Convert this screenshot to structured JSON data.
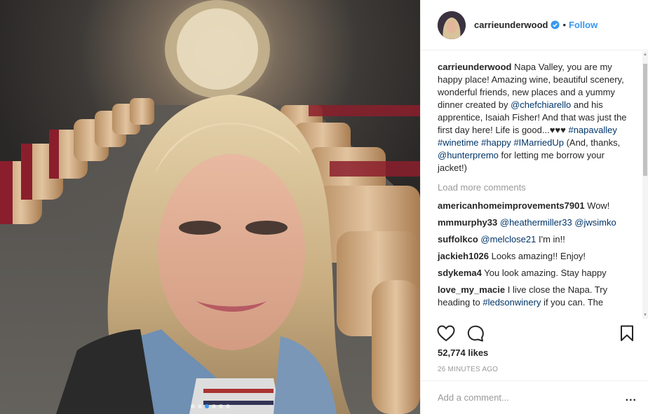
{
  "post": {
    "photo_alt": "Selfie in a wine barrel cellar",
    "carousel": {
      "count": 6,
      "active_index": 2
    }
  },
  "header": {
    "username": "carrieunderwood",
    "separator": "•",
    "follow_label": "Follow",
    "verified_icon": "verified-badge-icon"
  },
  "caption": {
    "username": "carrieunderwood",
    "parts": [
      {
        "t": "text",
        "v": " Napa Valley, you are my happy place! Amazing wine, beautiful scenery, wonderful friends, new places and a yummy dinner created by "
      },
      {
        "t": "link",
        "v": "@chefchiarello"
      },
      {
        "t": "text",
        "v": " and his apprentice, Isaiah Fisher! And that was just the first day here! Life is good...♥♥♥ "
      },
      {
        "t": "link",
        "v": "#napavalley"
      },
      {
        "t": "text",
        "v": " "
      },
      {
        "t": "link",
        "v": "#winetime"
      },
      {
        "t": "text",
        "v": " "
      },
      {
        "t": "link",
        "v": "#happy"
      },
      {
        "t": "text",
        "v": " "
      },
      {
        "t": "link",
        "v": "#IMarriedUp"
      },
      {
        "t": "text",
        "v": " (And, thanks, "
      },
      {
        "t": "link",
        "v": "@hunterpremo"
      },
      {
        "t": "text",
        "v": " for letting me borrow your jacket!)"
      }
    ]
  },
  "load_more_label": "Load more comments",
  "comments": [
    {
      "user": "americanhomeimprovements7901",
      "parts": [
        {
          "t": "text",
          "v": " Wow!"
        }
      ]
    },
    {
      "user": "mmmurphy33",
      "parts": [
        {
          "t": "text",
          "v": " "
        },
        {
          "t": "link",
          "v": "@heathermiller33"
        },
        {
          "t": "text",
          "v": " "
        },
        {
          "t": "link",
          "v": "@jwsimko"
        }
      ]
    },
    {
      "user": "suffolkco",
      "parts": [
        {
          "t": "text",
          "v": " "
        },
        {
          "t": "link",
          "v": "@melclose21"
        },
        {
          "t": "text",
          "v": " I'm in!!"
        }
      ]
    },
    {
      "user": "jackieh1026",
      "parts": [
        {
          "t": "text",
          "v": " Looks amazing!! Enjoy!"
        }
      ]
    },
    {
      "user": "sdykema4",
      "parts": [
        {
          "t": "text",
          "v": " You look amazing. Stay happy"
        }
      ]
    },
    {
      "user": "love_my_macie",
      "parts": [
        {
          "t": "text",
          "v": " I live close the Napa. Try heading to "
        },
        {
          "t": "link",
          "v": "#ledsonwinery"
        },
        {
          "t": "text",
          "v": " if you can. The"
        }
      ]
    }
  ],
  "actions": {
    "like_icon": "heart-icon",
    "comment_icon": "comment-icon",
    "save_icon": "bookmark-icon"
  },
  "likes_label": "52,774 likes",
  "timestamp": "26 MINUTES AGO",
  "add_comment": {
    "placeholder": "Add a comment...",
    "more_label": "..."
  },
  "colors": {
    "link": "#003569",
    "accent": "#3897f0",
    "muted": "#999999"
  }
}
